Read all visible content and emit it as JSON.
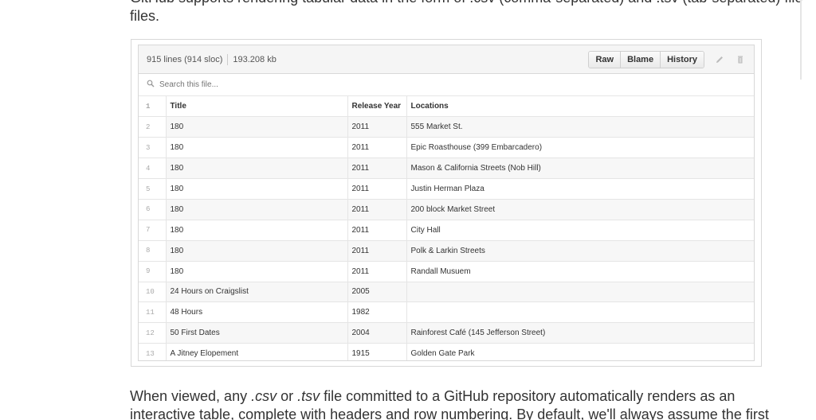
{
  "prose_top": "GitHub supports rendering tabular data in the form of .csv (comma-separated) and .tsv (tab-separated) files.",
  "prose_top_line2": "files.",
  "file_header": {
    "lines": "915 lines (914 sloc)",
    "size": "193.208 kb",
    "buttons": {
      "raw": "Raw",
      "blame": "Blame",
      "history": "History"
    }
  },
  "search": {
    "placeholder": "Search this file..."
  },
  "table": {
    "header": {
      "line": "1",
      "title": "Title",
      "year": "Release Year",
      "locations": "Locations"
    },
    "rows": [
      {
        "line": "2",
        "title": "180",
        "year": "2011",
        "locations": "555 Market St."
      },
      {
        "line": "3",
        "title": "180",
        "year": "2011",
        "locations": "Epic Roasthouse (399 Embarcadero)"
      },
      {
        "line": "4",
        "title": "180",
        "year": "2011",
        "locations": "Mason & California Streets (Nob Hill)"
      },
      {
        "line": "5",
        "title": "180",
        "year": "2011",
        "locations": "Justin Herman Plaza"
      },
      {
        "line": "6",
        "title": "180",
        "year": "2011",
        "locations": "200 block Market Street"
      },
      {
        "line": "7",
        "title": "180",
        "year": "2011",
        "locations": "City Hall"
      },
      {
        "line": "8",
        "title": "180",
        "year": "2011",
        "locations": "Polk & Larkin Streets"
      },
      {
        "line": "9",
        "title": "180",
        "year": "2011",
        "locations": "Randall Musuem"
      },
      {
        "line": "10",
        "title": "24 Hours on Craigslist",
        "year": "2005",
        "locations": ""
      },
      {
        "line": "11",
        "title": "48 Hours",
        "year": "1982",
        "locations": ""
      },
      {
        "line": "12",
        "title": "50 First Dates",
        "year": "2004",
        "locations": "Rainforest Café (145 Jefferson Street)"
      },
      {
        "line": "13",
        "title": "A Jitney Elopement",
        "year": "1915",
        "locations": "Golden Gate Park"
      }
    ]
  },
  "prose_bottom": {
    "part1": "When viewed, any ",
    "csv": ".csv",
    "part2": " or ",
    "tsv": ".tsv",
    "part3": " file committed to a GitHub repository automatically renders as an",
    "line2": "interactive table, complete with headers and row numbering. By default, we'll always assume the first"
  },
  "icons": {
    "search": "search-icon",
    "edit": "pencil-icon",
    "delete": "trash-icon"
  }
}
